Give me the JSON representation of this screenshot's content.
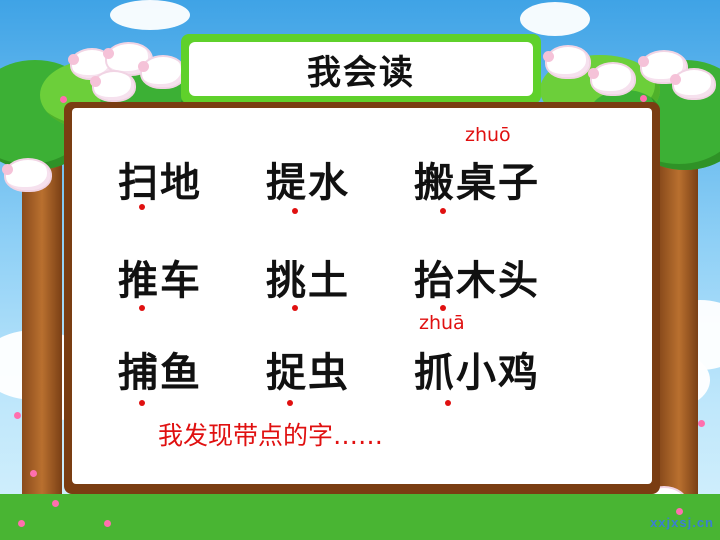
{
  "title": "我会读",
  "rows": [
    {
      "words": [
        "扫地",
        "提水",
        "搬桌子"
      ]
    },
    {
      "words": [
        "推车",
        "挑土",
        "抬木头"
      ]
    },
    {
      "words": [
        "捕鱼",
        "捉虫",
        "抓小鸡"
      ]
    }
  ],
  "pinyin": {
    "row1_col3": "zhuō",
    "row3_col3": "zhuā"
  },
  "note": "我发现带点的字……",
  "watermark": "xxjxsj.cn",
  "colors": {
    "title_frame": "#5fd12b",
    "board_frame": "#7a3d12",
    "emphasis_red": "#e01010"
  }
}
